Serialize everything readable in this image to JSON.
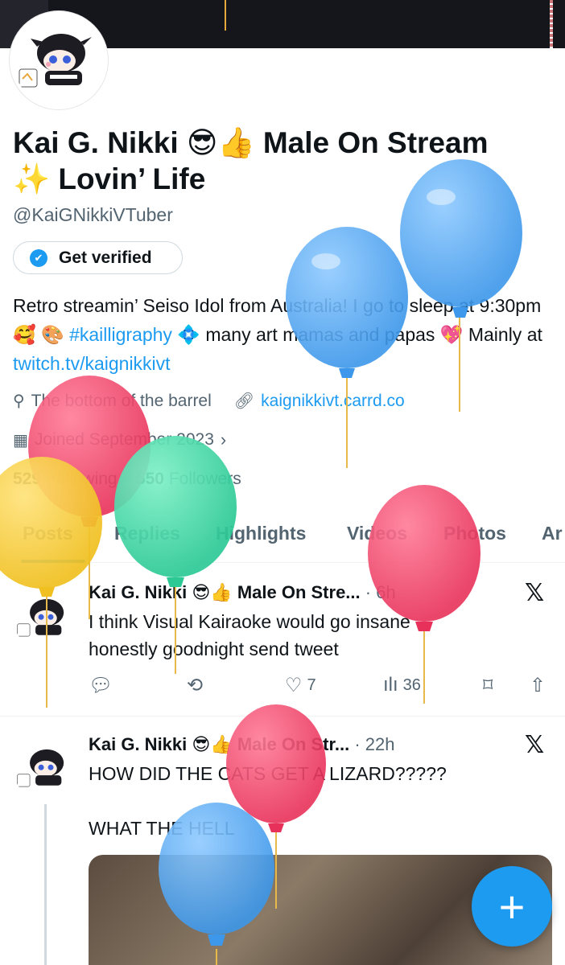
{
  "profile": {
    "name_line1": "Kai G. Nikki 😎👍 Male On Stream",
    "name_line2": "✨ Lovin’ Life",
    "handle": "@KaiGNikkiVTuber",
    "verify_label": "Get verified",
    "bio_part1": "Retro streamin’ Seiso Idol from Australia! I go to sleep at 9:30pm 🥰 🎨 ",
    "bio_hashtag": "#kailligraphy",
    "bio_part2": " 💠 many art mamas and papas 💖 Mainly at ",
    "bio_link": "twitch.tv/kaignikkivt",
    "location": "The bottom of the barrel",
    "website": "kaignikkivt.carrd.co",
    "joined": "Joined September 2023",
    "following_count": "529",
    "following_label": "Following",
    "followers_count": "550",
    "followers_label": "Followers"
  },
  "tabs": [
    "Posts",
    "Replies",
    "Highlights",
    "Videos",
    "Photos",
    "Ar"
  ],
  "tweets": [
    {
      "name": "Kai G. Nikki 😎👍 Male On Stre...",
      "time": "· 6h",
      "text": "I think Visual Kairaoke would go insane honestly goodnight send tweet",
      "likes": "7",
      "views": "36"
    },
    {
      "name": "Kai G. Nikki 😎👍 Male On Str...",
      "time": "· 22h",
      "text": "HOW DID THE CATS GET A LIZARD?????\n\nWHAT THE HELL"
    }
  ],
  "icons": {
    "location": "location-pin-icon",
    "link": "link-icon",
    "calendar": "calendar-icon",
    "x_logo": "x-logo-icon",
    "compose": "plus-icon"
  },
  "colors": {
    "accent": "#1d9bf0",
    "text": "#0f1419",
    "muted": "#536471",
    "balloon_blue": "#4da6f2",
    "balloon_red": "#f0436a",
    "balloon_green": "#3ddba8",
    "balloon_yellow": "#f6cd34"
  }
}
